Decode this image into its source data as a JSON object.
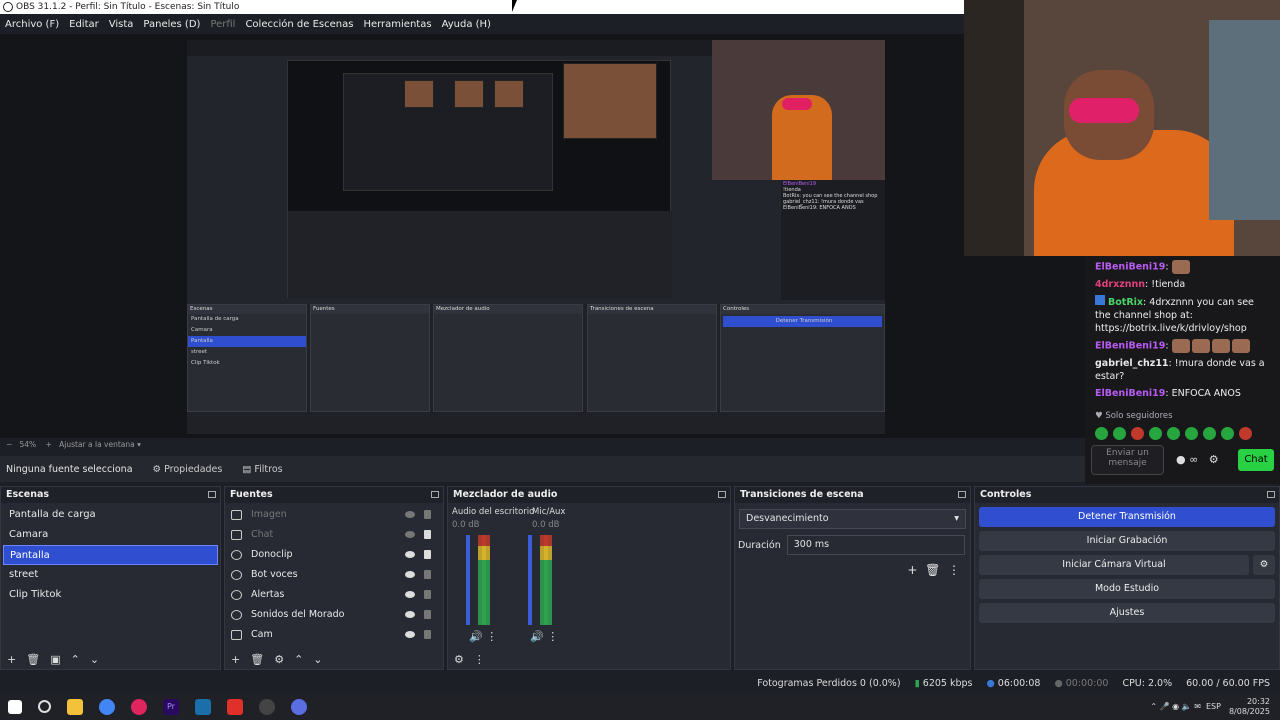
{
  "window": {
    "title": "OBS 31.1.2 - Perfil: Sin Título - Escenas: Sin Título"
  },
  "menu": [
    {
      "label": "Archivo (F)",
      "enabled": true
    },
    {
      "label": "Editar",
      "enabled": true
    },
    {
      "label": "Vista",
      "enabled": true
    },
    {
      "label": "Paneles (D)",
      "enabled": true
    },
    {
      "label": "Perfil",
      "enabled": false
    },
    {
      "label": "Colección de Escenas",
      "enabled": true
    },
    {
      "label": "Herramientas",
      "enabled": true
    },
    {
      "label": "Ayuda (H)",
      "enabled": true
    }
  ],
  "zoom": {
    "level": "54%",
    "fit_label": "Ajustar a la ventana"
  },
  "source_toolbar": {
    "no_source": "Ninguna fuente selecciona",
    "properties": "Propiedades",
    "filters": "Filtros"
  },
  "scenes": {
    "title": "Escenas",
    "items": [
      "Pantalla de carga",
      "Camara",
      "Pantalla",
      "street",
      "Clip Tiktok"
    ],
    "selected": "Pantalla"
  },
  "sources": {
    "title": "Fuentes",
    "items": [
      {
        "name": "Imagen",
        "visible": false
      },
      {
        "name": "Chat",
        "visible": false
      },
      {
        "name": "Donoclip",
        "visible": true
      },
      {
        "name": "Bot voces",
        "visible": true
      },
      {
        "name": "Alertas",
        "visible": true
      },
      {
        "name": "Sonidos del Morado",
        "visible": true
      },
      {
        "name": "Cam",
        "visible": true
      }
    ]
  },
  "mixer": {
    "title": "Mezclador de audio",
    "channels": [
      {
        "name": "Audio del escritorio",
        "db": "0.0 dB"
      },
      {
        "name": "Mic/Aux",
        "db": "0.0 dB"
      }
    ],
    "scale": [
      "0",
      "-5",
      "-10",
      "-15",
      "-20",
      "-25",
      "-30",
      "-35",
      "-40",
      "-45",
      "-50",
      "-55",
      "-60"
    ]
  },
  "transitions": {
    "title": "Transiciones de escena",
    "selected": "Desvanecimiento",
    "duration_label": "Duración",
    "duration_value": "300 ms"
  },
  "controls": {
    "title": "Controles",
    "buttons": [
      "Detener Transmisión",
      "Iniciar Grabación",
      "Iniciar Cámara Virtual",
      "Modo Estudio",
      "Ajustes"
    ]
  },
  "status": {
    "dropped": "Fotogramas Perdidos 0 (0.0%)",
    "bitrate": "6205 kbps",
    "stream_time": "06:00:08",
    "rec_time": "00:00:00",
    "cpu": "CPU: 2.0%",
    "fps": "60.00 / 60.00 FPS"
  },
  "chat": {
    "messages": [
      {
        "user": "ElBeniBeni19",
        "text": ""
      },
      {
        "user": "4drxznnn",
        "text": "!tienda"
      },
      {
        "user": "BotRix",
        "text": "4drxznnn you can see the channel shop at: https://botrix.live/k/drivloy/shop"
      },
      {
        "user": "ElBeniBeni19",
        "text": ""
      },
      {
        "user": "gabriel_chz11",
        "text": "!mura donde vas a estar?"
      },
      {
        "user": "ElBeniBeni19",
        "text": "ENFOCA ANOS"
      }
    ],
    "followers_only": "Solo seguidores",
    "input_placeholder": "Enviar un mensaje",
    "send_label": "Chat"
  },
  "taskbar": {
    "lang": "ESP",
    "time": "20:32",
    "date": "8/08/2025"
  }
}
